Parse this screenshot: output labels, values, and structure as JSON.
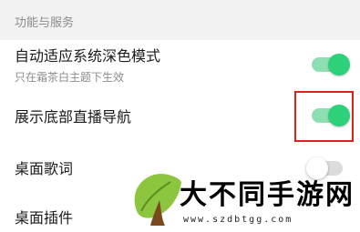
{
  "section": {
    "title": "功能与服务"
  },
  "rows": [
    {
      "label": "自动适应系统深色模式",
      "subtitle": "只在霜茶白主题下生效",
      "toggle": "on"
    },
    {
      "label": "展示底部直播导航",
      "toggle": "on",
      "highlighted": true
    },
    {
      "label": "桌面歌词",
      "toggle": "off"
    },
    {
      "label": "桌面插件"
    }
  ],
  "watermark": {
    "text": "大不同手游网",
    "url": "www.szdbtgg.com"
  },
  "colors": {
    "toggle_on": "#2ed07a",
    "highlight": "#e0201a"
  }
}
